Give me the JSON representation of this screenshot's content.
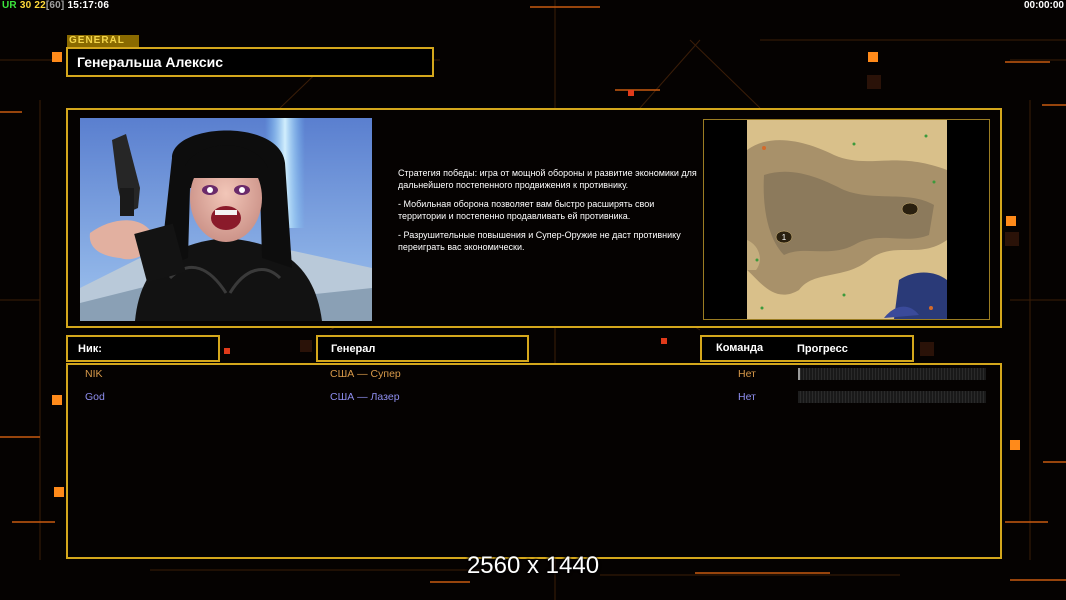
{
  "hud": {
    "ur_label": "UR",
    "fps": "30",
    "count": "22",
    "count_max": "[60]",
    "clock": "15:17:06",
    "timer": "00:00:00"
  },
  "header": {
    "tag": "GENERAL",
    "general_name": "Генеральша Алексис"
  },
  "description": {
    "paragraphs": [
      "Стратегия победы: игра от мощной обороны и развитие экономики для дальнейшего постепенного продвижения к противнику.",
      "- Мобильная оборона позволяет вам быстро расширять свои территории и постепенно продавливать ей противника.",
      "- Разрушительные повышения и Супер-Оружие не даст противнику переиграть вас экономически."
    ]
  },
  "minimap": {
    "start_positions": [
      "1",
      ""
    ]
  },
  "table": {
    "headers": {
      "nick": "Ник:",
      "general": "Генерал",
      "team": "Команда",
      "progress": "Прогресс"
    },
    "players": [
      {
        "nick": "NIK",
        "general": "США — Супер",
        "team": "Нет",
        "progress": 0.01,
        "color": "#d99a4a"
      },
      {
        "nick": "God",
        "general": "США — Лазер",
        "team": "Нет",
        "progress": 0,
        "color": "#8f8ff0"
      }
    ]
  },
  "watermark": "2560 x 1440",
  "colors": {
    "accent_gold": "#d4a71c",
    "hud_orange": "#ff8a1a",
    "background": "#050201"
  }
}
